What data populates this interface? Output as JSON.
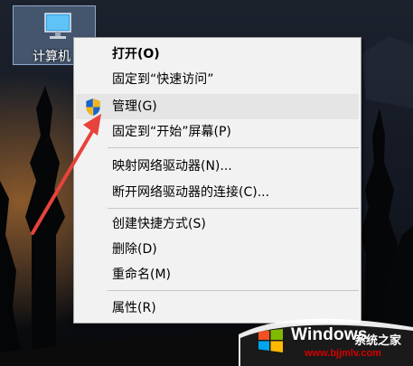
{
  "desktop": {
    "icon_label": "计算机"
  },
  "context_menu": {
    "items": [
      {
        "label": "打开(O)",
        "bold": true
      },
      {
        "label": "固定到“快速访问”"
      },
      {
        "label": "管理(G)",
        "icon": "uac-shield-icon",
        "highlighted": true
      },
      {
        "label": "固定到“开始”屏幕(P)"
      },
      {
        "label": "映射网络驱动器(N)..."
      },
      {
        "label": "断开网络驱动器的连接(C)..."
      },
      {
        "label": "创建快捷方式(S)"
      },
      {
        "label": "删除(D)"
      },
      {
        "label": "重命名(M)"
      },
      {
        "label": "属性(R)"
      }
    ]
  },
  "watermark": {
    "brand": "Windows",
    "brand_cn": "系统之家",
    "url": "www.bjjmlv.com"
  },
  "colors": {
    "menu_bg": "#f2f2f2",
    "highlight": "#e5e5e5",
    "arrow": "#e8423c"
  }
}
